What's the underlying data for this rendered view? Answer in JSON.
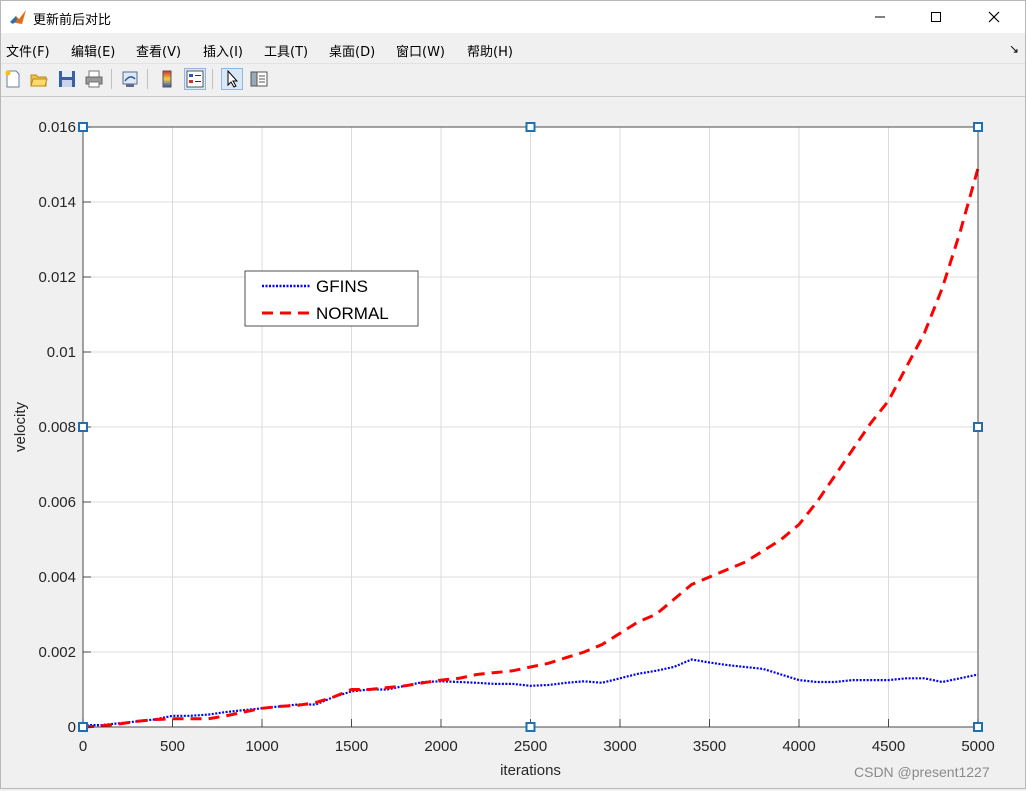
{
  "window": {
    "title": "更新前后对比",
    "controls": {
      "minimize": "minimize",
      "maximize": "maximize",
      "close": "close"
    }
  },
  "menu": {
    "items": [
      "文件(F)",
      "编辑(E)",
      "查看(V)",
      "插入(I)",
      "工具(T)",
      "桌面(D)",
      "窗口(W)",
      "帮助(H)"
    ],
    "more_icon": "↘"
  },
  "toolbar": {
    "buttons": [
      {
        "name": "new-figure-icon",
        "pressed": false
      },
      {
        "name": "open-file-icon",
        "pressed": false
      },
      {
        "name": "save-icon",
        "pressed": false
      },
      {
        "name": "print-icon",
        "pressed": false
      },
      {
        "name": "link-plot-icon",
        "pressed": false
      },
      {
        "name": "colorbar-icon",
        "pressed": false
      },
      {
        "name": "legend-icon",
        "pressed": true
      },
      {
        "name": "edit-plot-icon",
        "pressed": true
      },
      {
        "name": "property-inspector-icon",
        "pressed": false
      }
    ]
  },
  "watermark": "CSDN @present1227",
  "colors": {
    "gfins": "#0000ff",
    "normal": "#ff0000",
    "selection_handle": "#1f6fb2"
  },
  "chart_data": {
    "type": "line",
    "xlabel": "iterations",
    "ylabel": "velocity",
    "xlim": [
      0,
      5000
    ],
    "ylim": [
      0,
      0.016
    ],
    "xticks": [
      "0",
      "500",
      "1000",
      "1500",
      "2000",
      "2500",
      "3000",
      "3500",
      "4000",
      "4500",
      "5000"
    ],
    "yticks": [
      "0",
      "0.002",
      "0.004",
      "0.006",
      "0.008",
      "0.01",
      "0.012",
      "0.014",
      "0.016"
    ],
    "grid": true,
    "legend_position": "upper-left (inside axes)",
    "series": [
      {
        "name": "GFINS",
        "style": "dotted",
        "color": "#0000ff",
        "x": [
          0,
          100,
          200,
          300,
          400,
          500,
          600,
          700,
          800,
          900,
          1000,
          1100,
          1200,
          1300,
          1400,
          1500,
          1600,
          1700,
          1800,
          1900,
          2000,
          2100,
          2200,
          2300,
          2400,
          2500,
          2600,
          2700,
          2800,
          2900,
          3000,
          3100,
          3200,
          3300,
          3400,
          3500,
          3600,
          3700,
          3800,
          3900,
          4000,
          4100,
          4200,
          4300,
          4400,
          4500,
          4600,
          4700,
          4800,
          4900,
          5000
        ],
        "y": [
          5e-05,
          5e-05,
          0.0001,
          0.00015,
          0.0002,
          0.0003,
          0.0003,
          0.00033,
          0.0004,
          0.00045,
          0.0005,
          0.00055,
          0.0006,
          0.0006,
          0.0008,
          0.00095,
          0.001,
          0.001,
          0.0011,
          0.0012,
          0.00122,
          0.0012,
          0.00118,
          0.00115,
          0.00115,
          0.0011,
          0.00112,
          0.00118,
          0.00122,
          0.00118,
          0.0013,
          0.00142,
          0.0015,
          0.0016,
          0.0018,
          0.00172,
          0.00165,
          0.0016,
          0.00155,
          0.0014,
          0.00125,
          0.0012,
          0.0012,
          0.00125,
          0.00125,
          0.00125,
          0.0013,
          0.0013,
          0.0012,
          0.0013,
          0.0014
        ]
      },
      {
        "name": "NORMAL",
        "style": "dashed",
        "color": "#ff0000",
        "x": [
          0,
          100,
          200,
          300,
          400,
          500,
          600,
          700,
          800,
          900,
          1000,
          1100,
          1200,
          1300,
          1400,
          1500,
          1600,
          1700,
          1800,
          1900,
          2000,
          2100,
          2200,
          2300,
          2400,
          2500,
          2600,
          2700,
          2800,
          2900,
          3000,
          3100,
          3200,
          3300,
          3400,
          3500,
          3600,
          3700,
          3800,
          3900,
          4000,
          4100,
          4200,
          4300,
          4400,
          4500,
          4600,
          4700,
          4800,
          4900,
          5000
        ],
        "y": [
          0,
          3e-05,
          8e-05,
          0.00015,
          0.0002,
          0.00022,
          0.00022,
          0.00022,
          0.0003,
          0.0004,
          0.0005,
          0.00055,
          0.00058,
          0.00065,
          0.0008,
          0.001,
          0.001,
          0.00105,
          0.0011,
          0.00118,
          0.00125,
          0.0013,
          0.0014,
          0.00145,
          0.0015,
          0.0016,
          0.0017,
          0.00185,
          0.002,
          0.0022,
          0.0025,
          0.0028,
          0.003,
          0.0034,
          0.0038,
          0.004,
          0.0042,
          0.0044,
          0.0047,
          0.005,
          0.0054,
          0.006,
          0.0067,
          0.0074,
          0.0081,
          0.0087,
          0.0096,
          0.0105,
          0.0117,
          0.0132,
          0.0149
        ]
      }
    ]
  }
}
